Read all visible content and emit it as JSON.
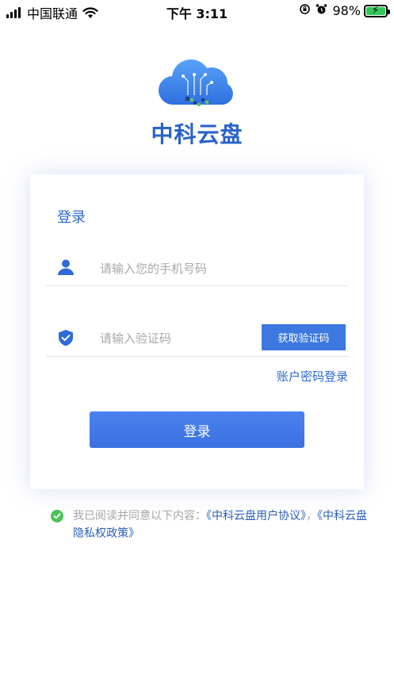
{
  "status_bar": {
    "carrier": "中国联通",
    "time": "下午 3:11",
    "battery_percent": "98%",
    "battery_level": 0.98
  },
  "app": {
    "name": "中科云盘",
    "brand_color": "#2a63c8"
  },
  "login_card": {
    "title": "登录",
    "phone_placeholder": "请输入您的手机号码",
    "code_placeholder": "请输入验证码",
    "get_code_label": "获取验证码",
    "password_login_label": "账户密码登录",
    "login_button_label": "登录"
  },
  "agreement": {
    "prefix": "我已阅读并同意以下内容：",
    "user_agreement": "《中科云盘用户协议》",
    "separator": "，",
    "privacy_policy": "《中科云盘隐私权政策》",
    "checked": true
  },
  "icons": {
    "user": "user-icon",
    "shield": "shield-check-icon",
    "check": "check-circle-icon",
    "wifi": "wifi-icon",
    "lock_rotation": "orientation-lock-icon",
    "alarm": "alarm-icon"
  }
}
